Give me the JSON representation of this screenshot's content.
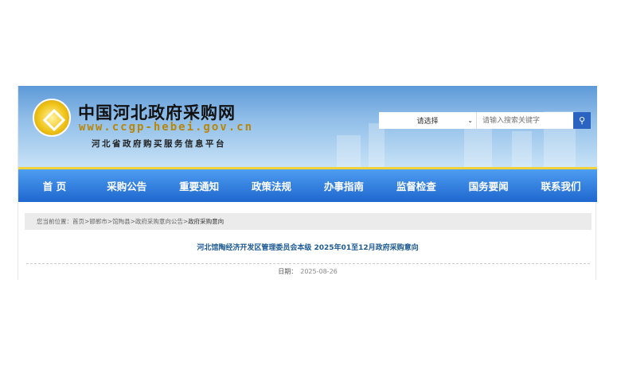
{
  "site": {
    "name": "中国河北政府采购网",
    "url": "www.ccgp-hebei.gov.cn",
    "subtitle": "河北省政府购买服务信息平台"
  },
  "search": {
    "select": "请选择",
    "placeholder": "请输入搜索关键字",
    "icon": "search-icon"
  },
  "nav": [
    "首 页",
    "采购公告",
    "重要通知",
    "政策法规",
    "办事指南",
    "监督检查",
    "国务要闻",
    "联系我们"
  ],
  "breadcrumb": {
    "label": "您当前位置：",
    "path": "首页>邯郸市>馆陶县>政府采购意向公告>",
    "current": "政府采购意向"
  },
  "article": {
    "title": "河北馆陶经济开发区管理委员会本级 2025年01至12月政府采购意向",
    "date_label": "日期：",
    "date": "2025-08-26"
  },
  "colors": {
    "nav": "#2a73d8",
    "accent": "#f2d23a",
    "title": "#1d5a94"
  }
}
